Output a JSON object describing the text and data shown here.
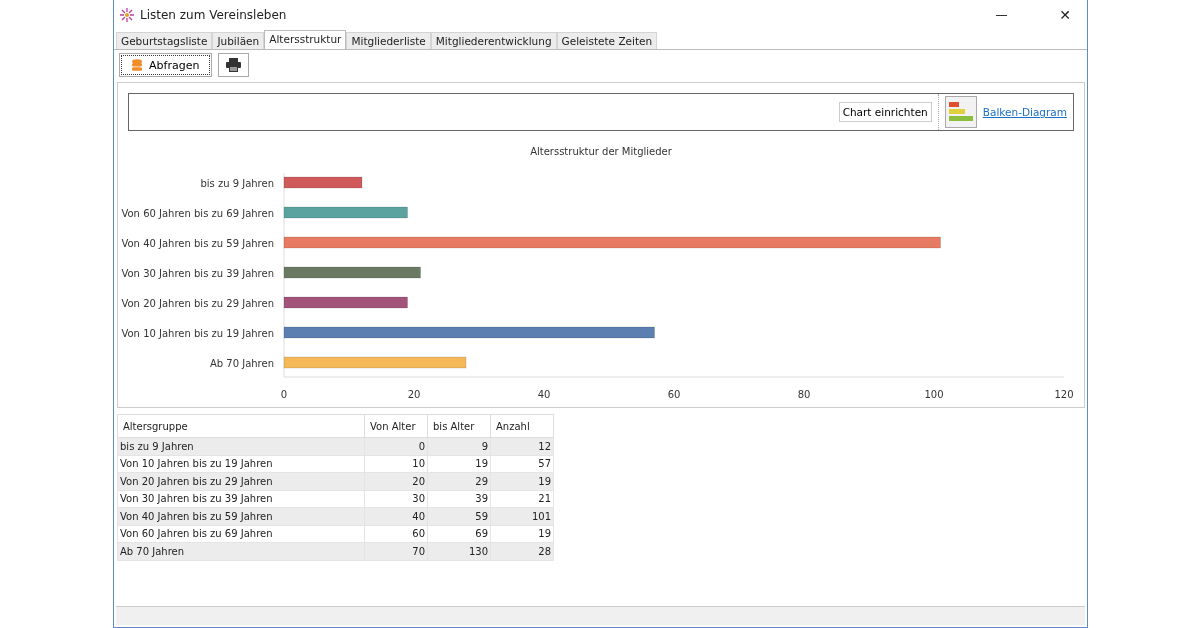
{
  "window": {
    "title": "Listen zum Vereinsleben",
    "close": "✕"
  },
  "tabs": [
    {
      "label": "Geburtstagsliste",
      "selected": false
    },
    {
      "label": "Jubiläen",
      "selected": false
    },
    {
      "label": "Altersstruktur",
      "selected": true
    },
    {
      "label": "Mitgliederliste",
      "selected": false
    },
    {
      "label": "Mitgliederentwicklung",
      "selected": false
    },
    {
      "label": "Geleistete Zeiten",
      "selected": false
    }
  ],
  "toolbar": {
    "query_button": "Abfragen"
  },
  "chart_panel": {
    "setup_button": "Chart einrichten",
    "chart_type_link": "Balken-Diagram",
    "chart_data": {
      "type": "bar",
      "orientation": "horizontal",
      "title": "Altersstruktur der Mitglieder",
      "categories": [
        "bis zu 9 Jahren",
        "Von 60 Jahren bis zu 69 Jahren",
        "Von 40 Jahren bis zu 59 Jahren",
        "Von 30 Jahren bis zu 39 Jahren",
        "Von 20 Jahren bis zu 29 Jahren",
        "Von 10 Jahren bis zu 19 Jahren",
        "Ab 70 Jahren"
      ],
      "values": [
        12,
        19,
        101,
        21,
        19,
        57,
        28
      ],
      "colors": [
        "#d05a5a",
        "#5aa39e",
        "#e77a62",
        "#6a7a62",
        "#a3537a",
        "#5a7fb0",
        "#f5b95a"
      ],
      "xlim": [
        0,
        120
      ],
      "xticks": [
        0,
        20,
        40,
        60,
        80,
        100,
        120
      ]
    }
  },
  "table": {
    "columns": [
      "Altersgruppe",
      "Von Alter",
      "bis Alter",
      "Anzahl"
    ],
    "rows": [
      [
        "bis zu 9 Jahren",
        "0",
        "9",
        "12"
      ],
      [
        "Von 10 Jahren bis zu 19 Jahren",
        "10",
        "19",
        "57"
      ],
      [
        "Von 20 Jahren bis zu 29 Jahren",
        "20",
        "29",
        "19"
      ],
      [
        "Von 30 Jahren bis zu 39 Jahren",
        "30",
        "39",
        "21"
      ],
      [
        "Von 40 Jahren bis zu 59 Jahren",
        "40",
        "59",
        "101"
      ],
      [
        "Von 60 Jahren bis zu 69 Jahren",
        "60",
        "69",
        "19"
      ],
      [
        "Ab 70 Jahren",
        "70",
        "130",
        "28"
      ]
    ]
  }
}
